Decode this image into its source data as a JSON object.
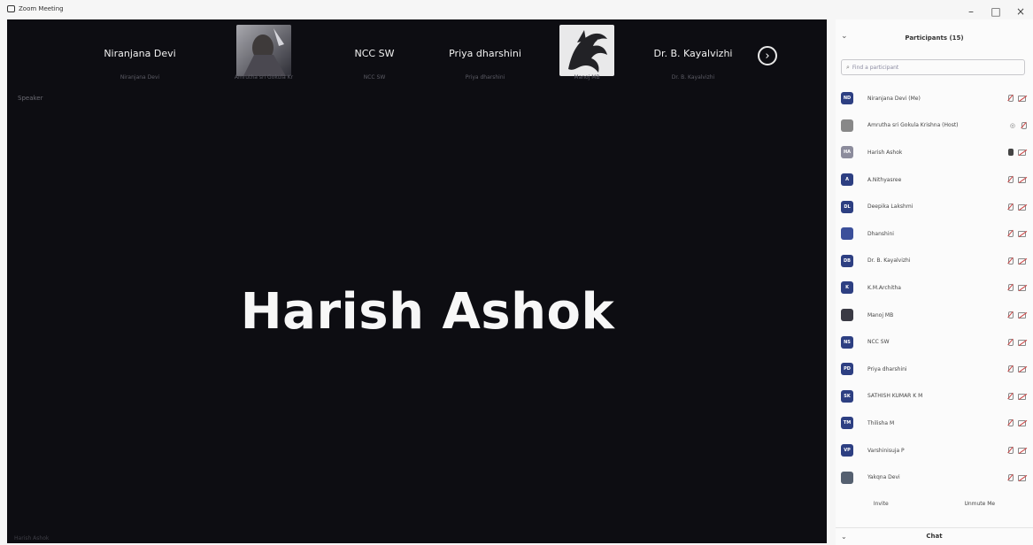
{
  "window": {
    "title": "Zoom Meeting",
    "controls": [
      "–",
      "□",
      "×"
    ]
  },
  "stage": {
    "tiles": [
      {
        "name": "Niranjana Devi",
        "sub": "Niranjana Devi",
        "type": "name"
      },
      {
        "name": "",
        "sub": "Amrutha sri Gokula Kr",
        "type": "image",
        "image": "portrait-photo"
      },
      {
        "name": "NCC SW",
        "sub": "NCC SW",
        "type": "name"
      },
      {
        "name": "Priya dharshini",
        "sub": "Priya dharshini",
        "type": "name"
      },
      {
        "name": "",
        "sub": "Manoj MB",
        "type": "image",
        "image": "dragon-logo"
      },
      {
        "name": "Dr. B. Kayalvizhi",
        "sub": "Dr. B. Kayalvizhi",
        "type": "name"
      }
    ],
    "next_icon": "›",
    "active_speaker": "Harish Ashok",
    "speaker_label_top": "Speaker",
    "speaker_label_bottom": "Harish Ashok"
  },
  "participants_panel": {
    "title": "Participants (15)",
    "search_placeholder": "Find a participant",
    "participants": [
      {
        "initials": "ND",
        "name": "Niranjana Devi (Me)",
        "mic": "muted",
        "cam": "muted",
        "avatar_color": "#2d3f82"
      },
      {
        "initials": "",
        "name": "Amrutha sri Gokula Krishna (Host)",
        "mic": "muted",
        "cam": "none",
        "extra": "◎",
        "avatar_color": "#888888"
      },
      {
        "initials": "HA",
        "name": "Harish Ashok",
        "mic": "live",
        "cam": "muted",
        "avatar_color": "#8c8c9c"
      },
      {
        "initials": "A",
        "name": "A.Nithyasree",
        "mic": "muted",
        "cam": "muted",
        "avatar_color": "#2d3f82"
      },
      {
        "initials": "DL",
        "name": "Deepika Lakshmi",
        "mic": "muted",
        "cam": "muted",
        "avatar_color": "#2d3f82"
      },
      {
        "initials": "",
        "name": "Dhanshini",
        "mic": "muted",
        "cam": "muted",
        "avatar_color": "#3b4f9a"
      },
      {
        "initials": "DB",
        "name": "Dr. B. Kayalvizhi",
        "mic": "muted",
        "cam": "muted",
        "avatar_color": "#2d3f82"
      },
      {
        "initials": "K",
        "name": "K.M.Architha",
        "mic": "muted",
        "cam": "muted",
        "avatar_color": "#2d3f82"
      },
      {
        "initials": "",
        "name": "Manoj MB",
        "mic": "muted",
        "cam": "muted",
        "avatar_color": "#3a3a44"
      },
      {
        "initials": "NS",
        "name": "NCC SW",
        "mic": "muted",
        "cam": "muted",
        "avatar_color": "#2d3f82"
      },
      {
        "initials": "PD",
        "name": "Priya dharshini",
        "mic": "muted",
        "cam": "muted",
        "avatar_color": "#2d3f82"
      },
      {
        "initials": "SK",
        "name": "SATHISH KUMAR K M",
        "mic": "muted",
        "cam": "muted",
        "avatar_color": "#2d3f82"
      },
      {
        "initials": "TM",
        "name": "Thilisha M",
        "mic": "muted",
        "cam": "muted",
        "avatar_color": "#2d3f82"
      },
      {
        "initials": "VP",
        "name": "Varshinisuja P",
        "mic": "muted",
        "cam": "muted",
        "avatar_color": "#2d3f82"
      },
      {
        "initials": "",
        "name": "Yakqna Devi",
        "mic": "muted",
        "cam": "muted",
        "avatar_color": "#556070"
      }
    ],
    "invite_label": "Invite",
    "unmute_label": "Unmute Me",
    "chat_title": "Chat"
  },
  "colors": {
    "stage_bg": "#0d0d12",
    "avatar_blue": "#2d3f82",
    "panel_bg": "#fbfbfb"
  }
}
